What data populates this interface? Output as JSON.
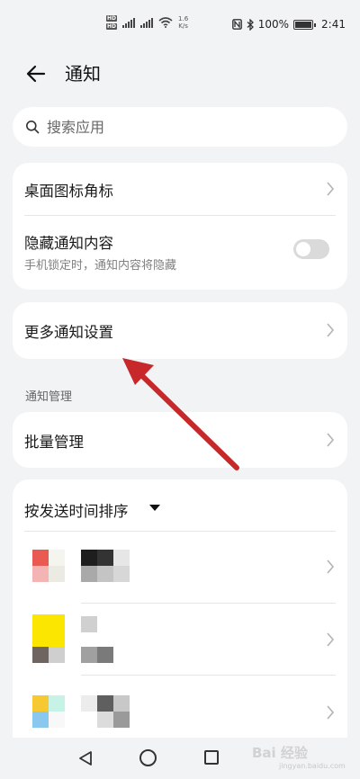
{
  "status_bar": {
    "net_speed": "1.6",
    "net_unit": "K/s",
    "signal_5g": "5G",
    "signal_4g": "4G",
    "hd1": "HD",
    "hd2": "HD",
    "battery_pct": "100%",
    "time": "2:41"
  },
  "header": {
    "title": "通知"
  },
  "search": {
    "placeholder": "搜索应用"
  },
  "settings_card": {
    "badge_label": "桌面图标角标",
    "hide_label": "隐藏通知内容",
    "hide_desc": "手机锁定时，通知内容将隐藏",
    "hide_enabled": false
  },
  "more_card": {
    "label": "更多通知设置"
  },
  "manage_section": {
    "heading": "通知管理",
    "batch_label": "批量管理"
  },
  "sort": {
    "label": "按发送时间排序"
  },
  "watermark": {
    "text": "Bai 经验",
    "sub": "jingyan.baidu.com"
  },
  "colors": {
    "arrow": "#c7282a",
    "toggle_off": "#dadada",
    "background": "#f1f3f5"
  }
}
